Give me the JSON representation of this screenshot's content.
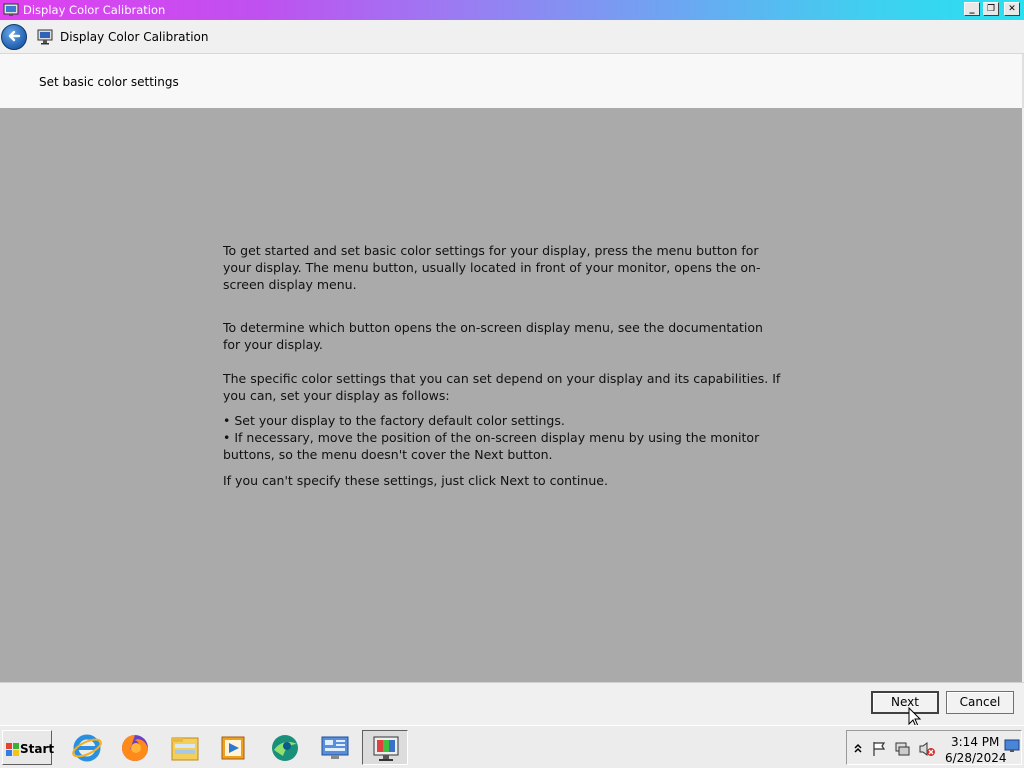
{
  "window": {
    "title": "Display Color Calibration",
    "minimize": "_",
    "maximize": "❐",
    "close": "✕"
  },
  "nav": {
    "title": "Display Color Calibration"
  },
  "header": {
    "heading": "Set basic color settings"
  },
  "content": {
    "paragraph1": "To get started and set basic color settings for your display, press the menu button for your display. The menu button, usually located in front of your monitor, opens the on-screen display menu.",
    "paragraph2": "To determine which button opens the on-screen display menu, see the documentation for your display.",
    "paragraph3": "The specific color settings that you can set depend on your display and its capabilities. If you can, set your display as follows:",
    "bullet1": "• Set your display to the factory default color settings.",
    "bullet2": "• If necessary, move the position of the on-screen display menu by using the monitor buttons, so the menu doesn't cover the Next button.",
    "paragraph4": "If you can't specify these settings,  just click Next to continue."
  },
  "footer": {
    "next_label": "Next",
    "cancel_label": "Cancel"
  },
  "taskbar": {
    "start_label": "Start",
    "apps": [
      "internet-explorer",
      "firefox",
      "file-explorer",
      "media-player",
      "browser",
      "control-panel",
      "display-color-calibration"
    ],
    "clock_time": "3:14 PM",
    "clock_date": "6/28/2024"
  }
}
